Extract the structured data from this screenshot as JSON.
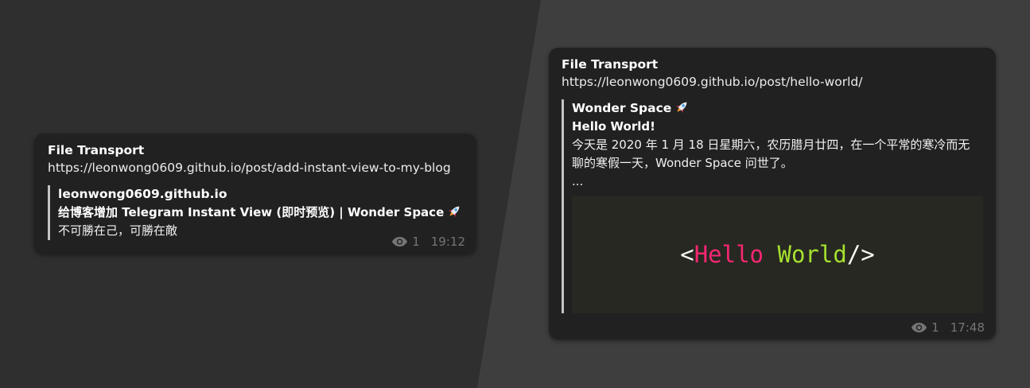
{
  "colors": {
    "background_left": "#2f2f2f",
    "background_right": "#3e3e3e",
    "card": "#212121",
    "meta_text": "#757575",
    "code_bg": "#272822",
    "code_tag": "#f92672",
    "code_attr": "#a6e22e"
  },
  "messages": [
    {
      "sender": "File Transport",
      "url": "https://leonwong0609.github.io/post/add-instant-view-to-my-blog",
      "preview": {
        "site": "leonwong0609.github.io",
        "title": "给博客增加 Telegram Instant View (即时预览) | Wonder Space",
        "title_icon": "rocket-icon",
        "description": "不可勝在己，可勝在敵"
      },
      "views": "1",
      "time": "19:12"
    },
    {
      "sender": "File Transport",
      "url": "https://leonwong0609.github.io/post/hello-world/",
      "preview": {
        "site": "Wonder Space",
        "site_icon": "rocket-icon",
        "title": "Hello World!",
        "description": "今天是 2020 年 1 月 18 日星期六，农历腊月廿四，在一个平常的寒冷而无聊的寒假一天，Wonder Space 问世了。",
        "ellipsis": "...",
        "image": {
          "open": "<",
          "word1": "Hello",
          "space": " ",
          "word2": "World",
          "close": "/>"
        }
      },
      "views": "1",
      "time": "17:48"
    }
  ]
}
